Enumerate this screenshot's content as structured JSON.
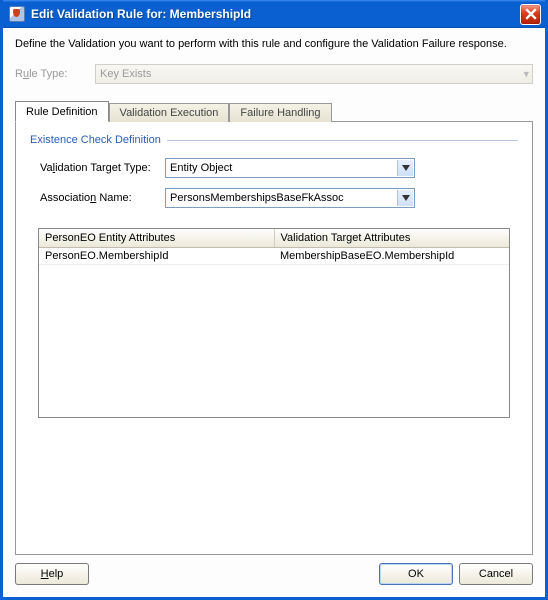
{
  "title": "Edit Validation Rule for: MembershipId",
  "intro": "Define the Validation you want to perform with this rule and configure the Validation Failure response.",
  "rule_type": {
    "label_pre": "R",
    "label_ul": "u",
    "label_post": "le Type:",
    "value": "Key Exists"
  },
  "tabs": {
    "definition": "Rule Definition",
    "execution": "Validation Execution",
    "failure": "Failure Handling"
  },
  "group": {
    "title": "Existence Check Definition"
  },
  "form": {
    "target_type": {
      "label_pre": "Va",
      "label_ul": "l",
      "label_post": "idation Target Type:",
      "value": "Entity Object"
    },
    "assoc_name": {
      "label_pre": "Associatio",
      "label_ul": "n",
      "label_post": " Name:",
      "value": "PersonsMembershipsBaseFkAssoc"
    }
  },
  "table": {
    "headers": {
      "left": "PersonEO Entity Attributes",
      "right": "Validation Target Attributes"
    },
    "rows": [
      {
        "left": "PersonEO.MembershipId",
        "right": "MembershipBaseEO.MembershipId"
      }
    ]
  },
  "buttons": {
    "help_ul": "H",
    "help_rest": "elp",
    "ok": "OK",
    "cancel": "Cancel"
  }
}
